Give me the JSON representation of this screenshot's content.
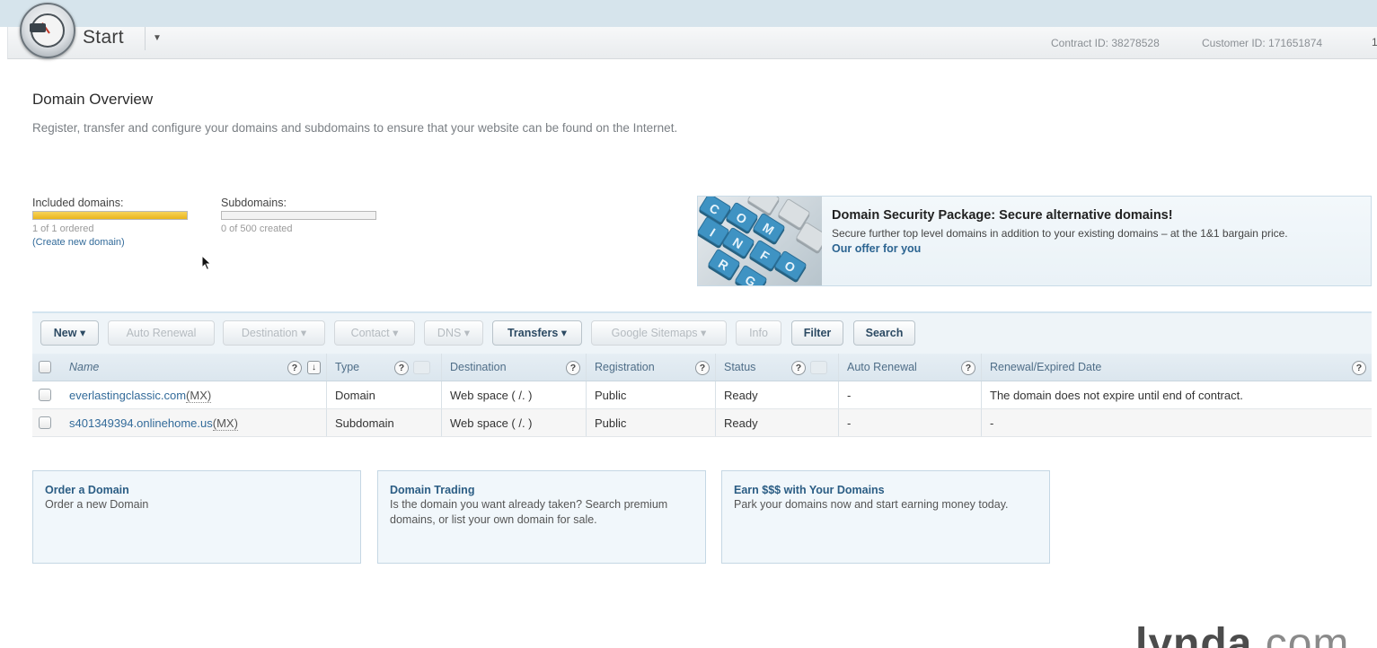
{
  "header": {
    "title": "Start",
    "contract_id": "Contract ID: 38278528",
    "customer_id": "Customer ID: 171651874",
    "edge_text": "1"
  },
  "page": {
    "title": "Domain Overview",
    "description": "Register, transfer and configure your domains and subdomains to ensure that your website can be found on the Internet."
  },
  "quotas": [
    {
      "label": "Included domains:",
      "sub": "1 of 1 ordered",
      "link": "(Create new domain)",
      "fill_fraction": 1.0
    },
    {
      "label": "Subdomains:",
      "sub": "0 of 500 created",
      "fill_fraction": 0.0
    }
  ],
  "promo": {
    "title": "Domain Security Package: Secure alternative domains!",
    "text": "Secure further top level domains in addition to your existing domains – at the 1&1 bargain price.",
    "link": "Our offer for you",
    "key_letters": [
      "C",
      "O",
      "M",
      "I",
      "N",
      "F",
      "O",
      "R",
      "G"
    ]
  },
  "toolbar": {
    "buttons": [
      {
        "label": "New ▾",
        "enabled": true
      },
      {
        "label": "Auto Renewal",
        "enabled": false
      },
      {
        "label": "Destination ▾",
        "enabled": false
      },
      {
        "label": "Contact ▾",
        "enabled": false
      },
      {
        "label": "DNS ▾",
        "enabled": false
      },
      {
        "label": "Transfers ▾",
        "enabled": true
      },
      {
        "label": "Google Sitemaps ▾",
        "enabled": false
      },
      {
        "label": "Info",
        "enabled": false
      },
      {
        "label": "Filter",
        "enabled": true
      },
      {
        "label": "Search",
        "enabled": true
      }
    ]
  },
  "table": {
    "columns": [
      "Name",
      "Type",
      "Destination",
      "Registration",
      "Status",
      "Auto Renewal",
      "Renewal/Expired Date"
    ],
    "help_glyph": "?",
    "sort_glyph": "↓",
    "rows": [
      {
        "name": "everlastingclassic.com",
        "mx": "(MX)",
        "type": "Domain",
        "destination": "Web space ( /. )",
        "registration": "Public",
        "status": "Ready",
        "auto_renewal": "-",
        "renewal": "The domain does not expire until end of contract."
      },
      {
        "name": "s401349394.onlinehome.us",
        "mx": "(MX)",
        "type": "Subdomain",
        "destination": "Web space ( /. )",
        "registration": "Public",
        "status": "Ready",
        "auto_renewal": "-",
        "renewal": "-"
      }
    ]
  },
  "infoboxes": [
    {
      "title": "Order a Domain",
      "text": "Order a new Domain"
    },
    {
      "title": "Domain Trading",
      "text": "Is the domain you want already taken? Search premium domains, or list your own domain for sale."
    },
    {
      "title": "Earn $$$ with Your Domains",
      "text": "Park your domains now and start earning money today."
    }
  ],
  "watermark": {
    "main": "lynda",
    "suffix": ".com"
  },
  "colors": {
    "accent": "#336b9a",
    "progress": "#eab51d",
    "header_band": "#d6e4ec"
  },
  "icons": {
    "logo": "speedometer-logo",
    "dropdown": "caret-down-icon",
    "help": "help-icon",
    "sort": "sort-down-icon",
    "cursor": "mouse-pointer-icon"
  }
}
